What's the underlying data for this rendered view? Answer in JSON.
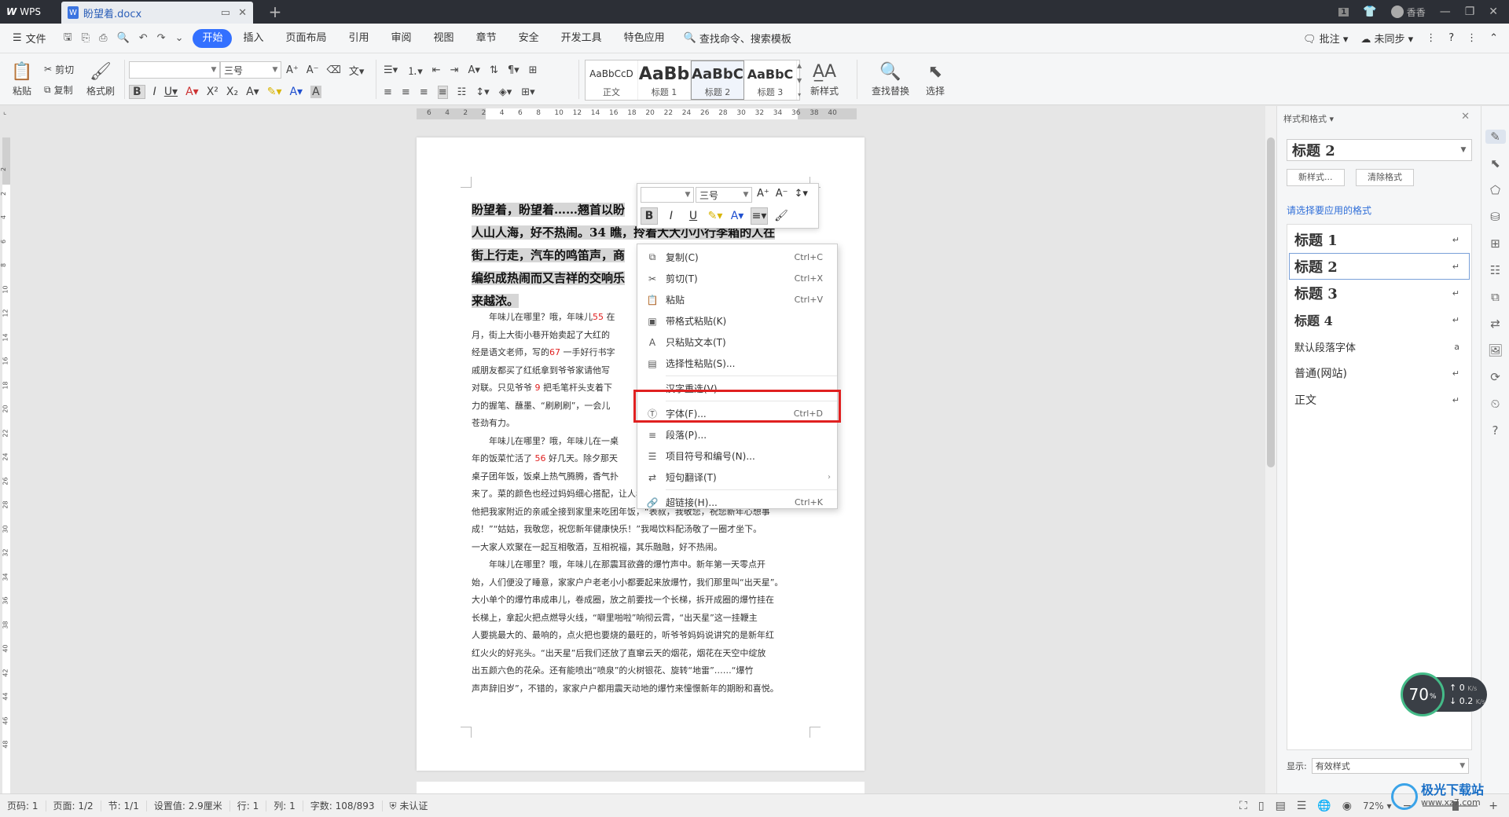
{
  "titlebar": {
    "app_label": "WPS",
    "doc_tab": "盼望着.docx",
    "new_tab": "+",
    "badge": "1",
    "user": "香香",
    "window_buttons": [
      "—",
      "❐",
      "✕"
    ]
  },
  "menubar": {
    "file": "文件",
    "tabs": [
      "开始",
      "插入",
      "页面布局",
      "引用",
      "审阅",
      "视图",
      "章节",
      "安全",
      "开发工具",
      "特色应用"
    ],
    "search": "查找命令、搜索模板",
    "right": [
      "批注",
      "未同步"
    ]
  },
  "ribbon": {
    "paste": "粘贴",
    "cut": "剪切",
    "copy": "复制",
    "format_painter": "格式刷",
    "font_name": "",
    "font_size": "三号",
    "styles": [
      {
        "preview": "AaBbCcD",
        "name": "正文"
      },
      {
        "preview": "AaBb",
        "name": "标题 1"
      },
      {
        "preview": "AaBbC",
        "name": "标题 2"
      },
      {
        "preview": "AaBbC",
        "name": "标题 3"
      }
    ],
    "new_style": "新样式",
    "find_replace": "查找替换",
    "select": "选择"
  },
  "ruler": {
    "h_ticks": [
      "6",
      "4",
      "2",
      "2",
      "4",
      "6",
      "8",
      "10",
      "12",
      "14",
      "16",
      "18",
      "20",
      "22",
      "24",
      "26",
      "28",
      "30",
      "32",
      "34",
      "36",
      "38",
      "40"
    ],
    "v_ticks": [
      "2",
      "2",
      "4",
      "6",
      "8",
      "10",
      "12",
      "14",
      "16",
      "18",
      "20",
      "22",
      "24",
      "26",
      "28",
      "30",
      "32",
      "34",
      "36",
      "38",
      "40",
      "42",
      "44",
      "46",
      "48"
    ]
  },
  "document": {
    "heading_lines": [
      "盼望着，盼望着……翘首以盼",
      "人山人海，好不热闹。34 瞧，拎着大大小小行李箱的人在",
      "街上行走，汽车的鸣笛声，商",
      "编织成热闹而又吉祥的交响乐",
      "来越浓。"
    ],
    "paragraphs": [
      {
        "lines": [
          [
            {
              "t": "年味儿在哪里？哦，年味儿"
            },
            {
              "t": "55",
              "red": true
            },
            {
              "t": " 在"
            }
          ],
          [
            {
              "t": "月，街上大街小巷开始卖起了大红的"
            }
          ],
          [
            {
              "t": "经是语文老师，写的"
            },
            {
              "t": "67",
              "red": true
            },
            {
              "t": " 一手好行书字"
            }
          ],
          [
            {
              "t": "戚朋友都买了红纸拿到爷爷家请他写"
            }
          ],
          [
            {
              "t": "对联。只见爷爷 "
            },
            {
              "t": "9",
              "red": true
            },
            {
              "t": " 把毛笔杆头支着下"
            }
          ],
          [
            {
              "t": "力的握笔、蘸墨、“刷刷刷”，一会儿"
            }
          ],
          [
            {
              "t": "苍劲有力。"
            }
          ]
        ]
      },
      {
        "lines": [
          [
            {
              "t": "年味儿在哪里？哦，年味儿在一桌"
            }
          ],
          [
            {
              "t": "年的饭菜忙活了 "
            },
            {
              "t": "56",
              "red": true
            },
            {
              "t": " 好几天。除夕那天"
            }
          ],
          [
            {
              "t": "桌子团年饭，饭桌上热气腾腾，香气扑"
            }
          ],
          [
            {
              "t": "来了。菜的颜色也经过妈妈细心搭配，让人看了就有食欲。爸爸是个爱热闹的人，"
            }
          ],
          [
            {
              "t": "他把我家附近的亲戚全接到家里来吃团年饭，“表叔，我敬您，祝您新年心想事"
            }
          ],
          [
            {
              "t": "成！”“姑姑，我敬您，祝您新年健康快乐！”我喝饮料配汤敬了一圈才坐下。"
            }
          ],
          [
            {
              "t": "一大家人欢聚在一起互相敬酒，互相祝福，其乐融融，好不热闹。"
            }
          ]
        ]
      },
      {
        "lines": [
          [
            {
              "t": "年味儿在哪里？哦，年味儿在那震耳欲聋的爆竹声中。新年第一天零点开"
            }
          ],
          [
            {
              "t": "始，人们便没了睡意，家家户户老老小小都要起来放爆竹，我们那里叫“出天星”。"
            }
          ],
          [
            {
              "t": "大小单个的爆竹串成串儿，卷成圈，放之前要找一个长梯，拆开成圈的爆竹挂在"
            }
          ],
          [
            {
              "t": "长梯上，拿起火把点燃导火线，“噼里啪啦”响彻云霄，“出天星”这一挂鞭主"
            }
          ],
          [
            {
              "t": "人要挑最大的、最响的，点火把也要烧的最旺的，听爷爷妈妈说讲究的是新年红"
            }
          ],
          [
            {
              "t": "红火火的好兆头。“出天星”后我们还放了直窜云天的烟花，烟花在天空中绽放"
            }
          ],
          [
            {
              "t": "出五颜六色的花朵。还有能喷出“喷泉”的火树银花、旋转“地雷”……“爆竹"
            }
          ],
          [
            {
              "t": "声声辞旧岁”，不错的，家家户户都用震天动地的爆竹来憧憬新年的期盼和喜悦。"
            }
          ]
        ]
      }
    ]
  },
  "mini_toolbar": {
    "font_name": "",
    "font_size": "三号"
  },
  "context_menu": {
    "items": [
      {
        "icon": "⧉",
        "label": "复制(C)",
        "shortcut": "Ctrl+C"
      },
      {
        "icon": "✂",
        "label": "剪切(T)",
        "shortcut": "Ctrl+X"
      },
      {
        "icon": "📋",
        "label": "粘贴",
        "shortcut": "Ctrl+V"
      },
      {
        "icon": "▣",
        "label": "带格式粘贴(K)",
        "shortcut": ""
      },
      {
        "icon": "A",
        "label": "只粘贴文本(T)",
        "shortcut": ""
      },
      {
        "icon": "▤",
        "label": "选择性粘贴(S)...",
        "shortcut": ""
      },
      {
        "icon": "",
        "label": "汉字重选(V)",
        "shortcut": ""
      },
      {
        "icon": "Ⓣ",
        "label": "字体(F)...",
        "shortcut": "Ctrl+D"
      },
      {
        "icon": "≡",
        "label": "段落(P)...",
        "shortcut": ""
      },
      {
        "icon": "☰",
        "label": "项目符号和编号(N)...",
        "shortcut": ""
      },
      {
        "icon": "⇄",
        "label": "短句翻译(T)",
        "shortcut": ""
      },
      {
        "icon": "🔗",
        "label": "超链接(H)...",
        "shortcut": "Ctrl+K"
      }
    ]
  },
  "panel": {
    "title": "样式和格式",
    "current_style": "标题 2",
    "new_style_btn": "新样式...",
    "clear_format_btn": "清除格式",
    "apply_label": "请选择要应用的格式",
    "styles": [
      {
        "name": "标题 1",
        "mark": "↵"
      },
      {
        "name": "标题 2",
        "mark": "↵"
      },
      {
        "name": "标题 3",
        "mark": "↵"
      },
      {
        "name": "标题 4",
        "mark": "↵"
      },
      {
        "name": "默认段落字体",
        "mark": "a"
      },
      {
        "name": "普通(网站)",
        "mark": "↵"
      },
      {
        "name": "正文",
        "mark": "↵"
      }
    ],
    "show_label": "显示:",
    "show_value": "有效样式"
  },
  "speed_widget": {
    "percent": "70",
    "percent_unit": "%",
    "up": "0",
    "down": "0.2",
    "unit": "K/s"
  },
  "statusbar": {
    "items": [
      "页码: 1",
      "页面: 1/2",
      "节: 1/1",
      "设置值: 2.9厘米",
      "行: 1",
      "列: 1",
      "字数: 108/893",
      "未认证"
    ],
    "zoom": "72%"
  },
  "watermark": {
    "name": "极光下载站",
    "url": "www.xz7.com"
  }
}
